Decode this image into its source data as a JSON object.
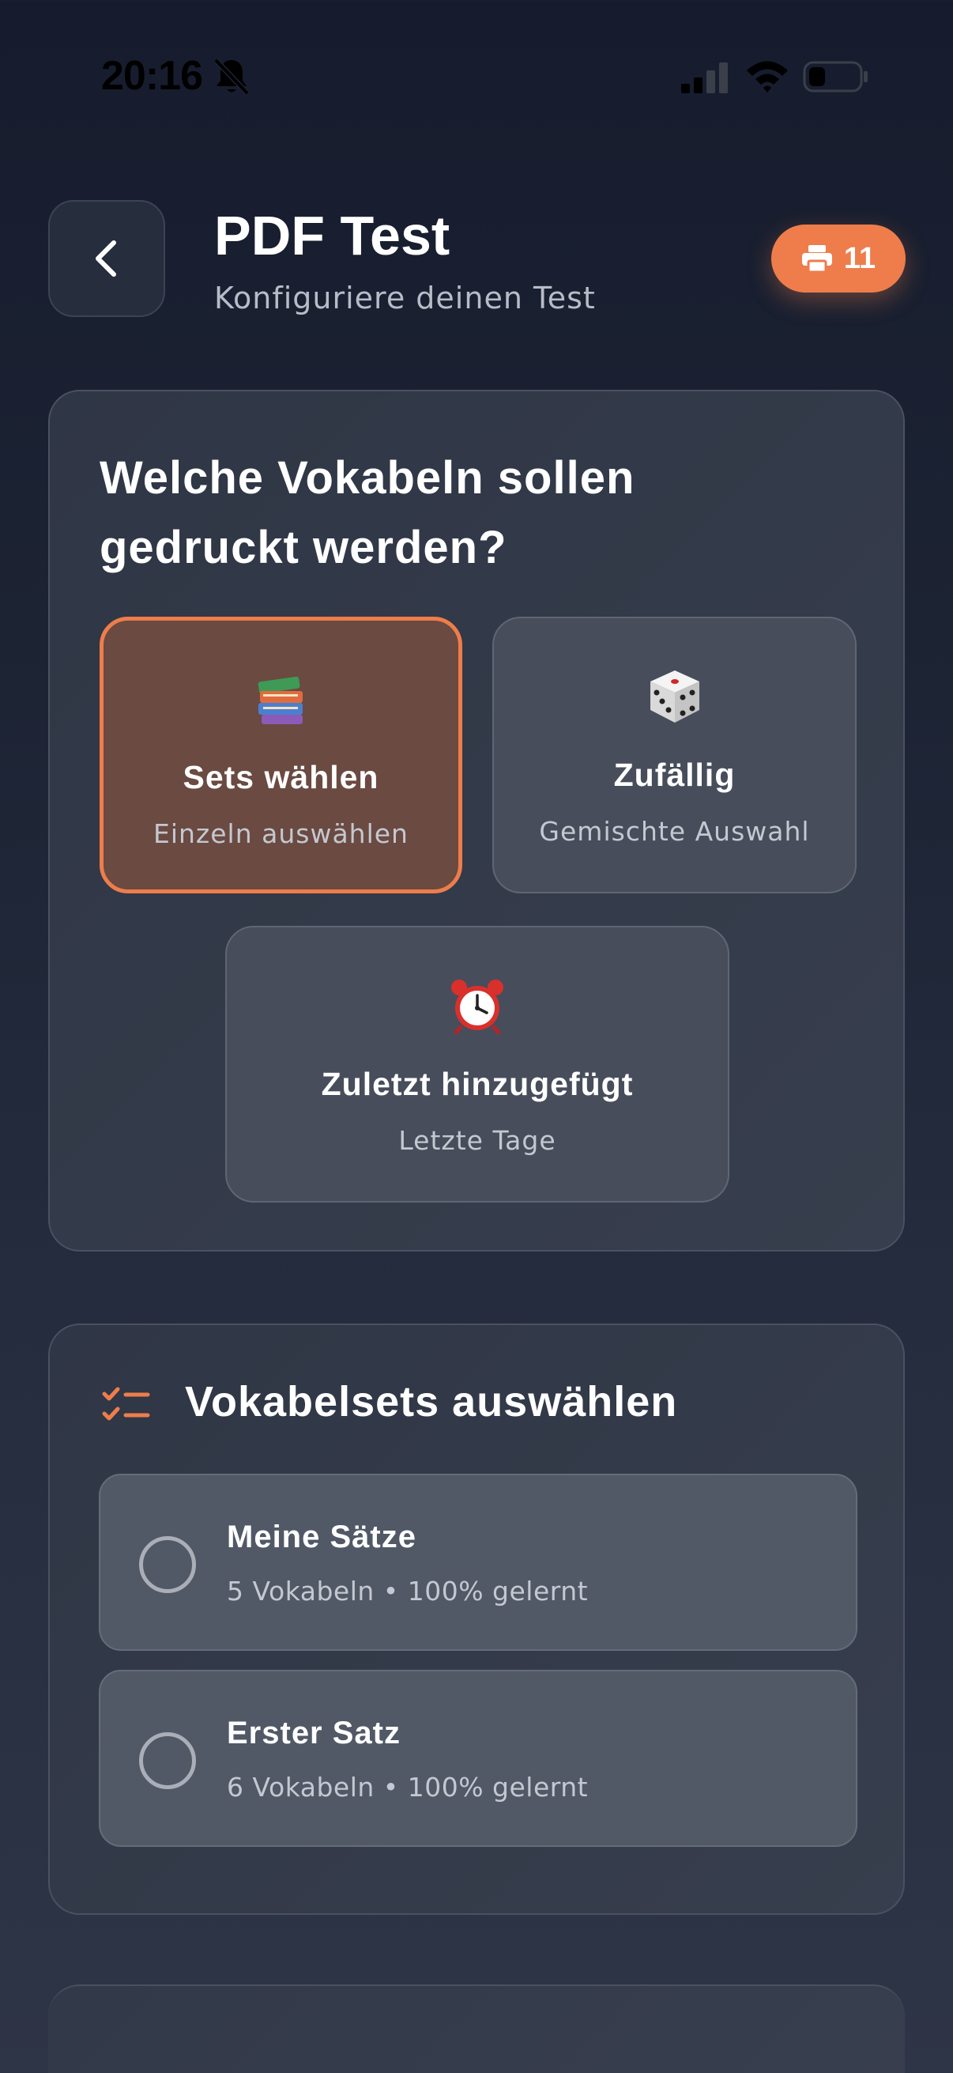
{
  "status_bar": {
    "time": "20:16"
  },
  "header": {
    "title": "PDF Test",
    "subtitle": "Konfiguriere deinen Test",
    "print_count": "11"
  },
  "mode_section": {
    "question": "Welche Vokabeln sollen gedruckt werden?",
    "options": [
      {
        "icon": "books-icon",
        "label": "Sets wählen",
        "description": "Einzeln auswählen",
        "selected": true
      },
      {
        "icon": "dice-icon",
        "label": "Zufällig",
        "description": "Gemischte Auswahl",
        "selected": false
      },
      {
        "icon": "alarm-clock-icon",
        "label": "Zuletzt hinzugefügt",
        "description": "Letzte Tage",
        "selected": false
      }
    ]
  },
  "sets_section": {
    "title": "Vokabelsets auswählen",
    "sets": [
      {
        "name": "Meine Sätze",
        "meta": "5 Vokabeln • 100% gelernt",
        "checked": false
      },
      {
        "name": "Erster Satz",
        "meta": "6 Vokabeln • 100% gelernt",
        "checked": false
      }
    ]
  },
  "colors": {
    "accent": "#ee7d4b",
    "background": "#1c2333",
    "card": "#343b4a"
  }
}
